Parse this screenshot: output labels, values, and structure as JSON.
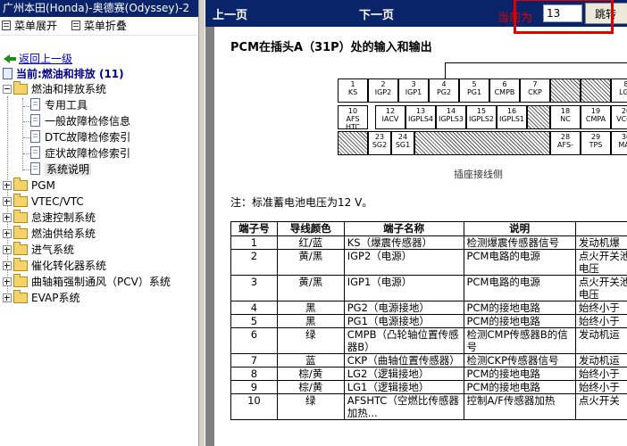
{
  "left_pane": {
    "title": "广州本田(Honda)-奥德赛(Odyssey)-2",
    "menu": {
      "expand_all": "菜单展开",
      "collapse_all": "菜单折叠"
    },
    "back_link": "返回上一级",
    "current_node": "当前:燃油和排放 (11)",
    "tree": [
      {
        "label": "燃油和排放系统",
        "expanded": true,
        "children": [
          "专用工具",
          "一般故障检修信息",
          "DTC故障检修索引",
          "症状故障检修索引",
          "系统说明"
        ]
      },
      {
        "label": "PGM"
      },
      {
        "label": "VTEC/VTC"
      },
      {
        "label": "怠速控制系统"
      },
      {
        "label": "燃油供给系统"
      },
      {
        "label": "进气系统"
      },
      {
        "label": "催化转化器系统"
      },
      {
        "label": "曲轴箱强制通风（PCV）系统"
      },
      {
        "label": "EVAP系统"
      }
    ],
    "selected_child": "系统说明"
  },
  "toolbar": {
    "prev_label": "上一页",
    "next_label": "下一页",
    "current_page_label": "当前为",
    "page_value": "13",
    "go_label": "跳转"
  },
  "document": {
    "title": "PCM在插头A（31P）处的输入和输出",
    "connector_caption": "插座接线侧",
    "note": "注：标准蓄电池电压为12 V。",
    "connector_pins": {
      "row1": [
        [
          "1",
          "KS"
        ],
        [
          "2",
          "IGP2"
        ],
        [
          "3",
          "IGP1"
        ],
        [
          "4",
          "PG2"
        ],
        [
          "5",
          "PG1"
        ],
        [
          "6",
          "CMPB"
        ],
        [
          "7",
          "CKP"
        ],
        [
          "8",
          "LG2"
        ]
      ],
      "row2": [
        [
          "10",
          "AFS HTC"
        ],
        [
          "12",
          "IACV"
        ],
        [
          "13",
          "IGPLS4"
        ],
        [
          "14",
          "IGPLS3"
        ],
        [
          "15",
          "IGPLS2"
        ],
        [
          "16",
          "IGPLS1"
        ],
        [
          "18",
          "NC"
        ],
        [
          "19",
          "CMPA"
        ],
        [
          "20",
          "VCC2"
        ]
      ],
      "row3": [
        [
          "23",
          "SG2"
        ],
        [
          "24",
          "SG1"
        ],
        [
          "28",
          "AFS-"
        ],
        [
          "29",
          "TPS"
        ],
        [
          "30",
          "MAP"
        ]
      ]
    },
    "table": {
      "headers": [
        "端子号",
        "导线颜色",
        "端子名称",
        "说明",
        ""
      ],
      "rows": [
        [
          "1",
          "红/蓝",
          "KS（爆震传感器）",
          "检测爆震传感器信号",
          "发动机爆"
        ],
        [
          "2",
          "黄/黑",
          "IGP2（电源）",
          "PCM电路的电源",
          "点火开关池电压"
        ],
        [
          "3",
          "黄/黑",
          "IGP1（电源）",
          "PCM电路的电源",
          "点火开关池电压"
        ],
        [
          "4",
          "黑",
          "PG2（电源接地）",
          "PCM的接地电路",
          "始终小于"
        ],
        [
          "5",
          "黑",
          "PG1（电源接地）",
          "PCM的接地电路",
          "始终小于"
        ],
        [
          "6",
          "绿",
          "CMPB（凸轮轴位置传感器B）",
          "检测CMP传感器B的信号",
          "发动机运"
        ],
        [
          "7",
          "蓝",
          "CKP（曲轴位置传感器）",
          "检测CKP传感器信号",
          "发动机运"
        ],
        [
          "8",
          "棕/黄",
          "LG2（逻辑接地）",
          "PCM的接地电路",
          "始终小于"
        ],
        [
          "9",
          "棕/黄",
          "LG1（逻辑接地）",
          "PCM的接地电路",
          "始终小于"
        ],
        [
          "10",
          "绿",
          "AFSHTC（空燃比传感器加热...",
          "控制A/F传感器加热",
          "点火开关"
        ]
      ]
    }
  }
}
